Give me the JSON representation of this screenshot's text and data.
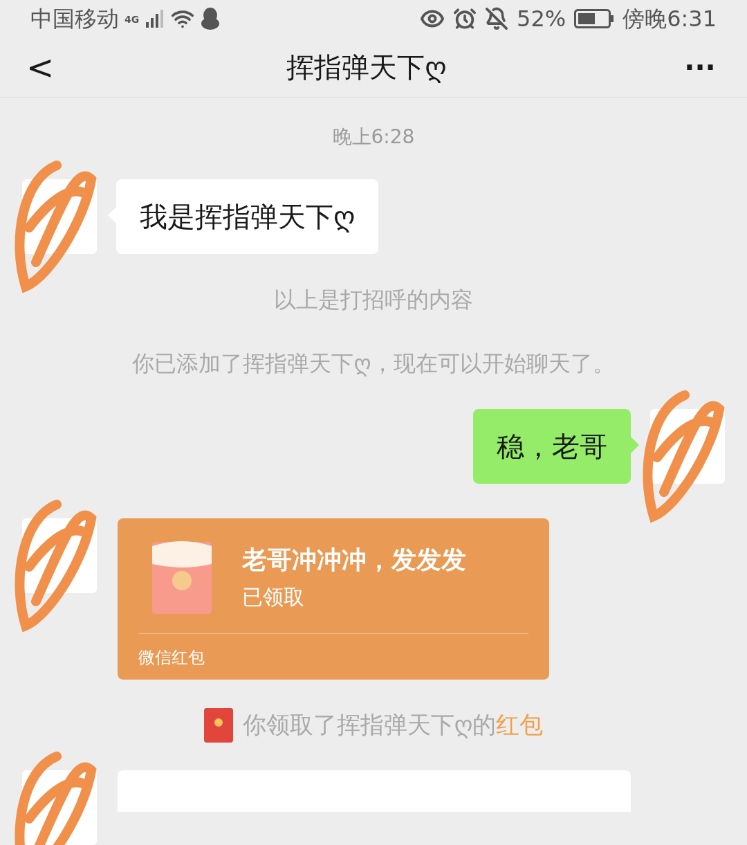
{
  "status_bar": {
    "carrier": "中国移动",
    "network": "4G",
    "battery_percent": "52%",
    "time": "傍晚6:31"
  },
  "header": {
    "back": "<",
    "title": "挥指弹天下ღ",
    "more": "···"
  },
  "messages": [
    {
      "kind": "time",
      "text": "晚上6:28"
    },
    {
      "kind": "received",
      "text": "我是挥指弹天下ღ"
    },
    {
      "kind": "system",
      "text": "以上是打招呼的内容"
    },
    {
      "kind": "system",
      "text": "你已添加了挥指弹天下ღ，现在可以开始聊天了。"
    },
    {
      "kind": "sent",
      "text": "稳，老哥"
    },
    {
      "kind": "redpacket",
      "title": "老哥冲冲冲，发发发",
      "status": "已领取",
      "footer": "微信红包",
      "claimed": true
    },
    {
      "kind": "notice",
      "text": "你领取了挥指弹天下ღ的",
      "link": "红包"
    },
    {
      "kind": "cutoff"
    }
  ]
}
